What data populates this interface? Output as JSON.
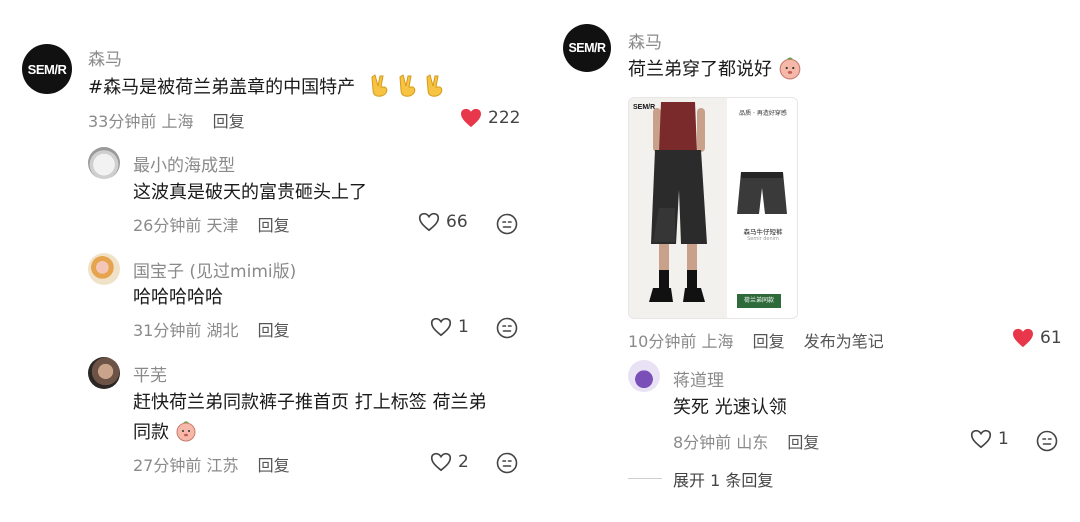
{
  "left": {
    "main_comment": {
      "author": "森马",
      "avatar_text": "SEM/R",
      "text": "#森马是被荷兰弟盖章的中国特产",
      "time": "33分钟前",
      "location": "上海",
      "reply_label": "回复",
      "likes": "222"
    },
    "replies": [
      {
        "author": "最小的海成型",
        "text": "这波真是破天的富贵砸头上了",
        "time": "26分钟前",
        "location": "天津",
        "reply_label": "回复",
        "likes": "66"
      },
      {
        "author": "国宝子 (见过mimi版)",
        "text": "哈哈哈哈哈",
        "time": "31分钟前",
        "location": "湖北",
        "reply_label": "回复",
        "likes": "1"
      },
      {
        "author": "平芜",
        "text_line1": "赶快荷兰弟同款裤子推首页 打上标签 荷兰弟",
        "text_line2": "同款",
        "time": "27分钟前",
        "location": "江苏",
        "reply_label": "回复",
        "likes": "2"
      }
    ]
  },
  "right": {
    "main_comment": {
      "author": "森马",
      "avatar_text": "SEM/R",
      "text": "荷兰弟穿了都说好",
      "time": "10分钟前",
      "location": "上海",
      "reply_label": "回复",
      "publish_note": "发布为笔记",
      "likes": "61"
    },
    "product": {
      "brand": "SEM/R",
      "header": "品质 · 再造好穿感",
      "item_name": "森马牛仔短裤",
      "item_sub": "Semir denim",
      "button": "荷兰弟同款"
    },
    "reply": {
      "author": "蒋道理",
      "text": "笑死 光速认领",
      "time": "8分钟前",
      "location": "山东",
      "reply_label": "回复",
      "likes": "1"
    },
    "expand_label": "展开 1 条回复"
  },
  "colors": {
    "heart_red": "#e8364a",
    "meta_gray": "#8a8a8a"
  },
  "icons": [
    "heart-filled-icon",
    "heart-outline-icon",
    "emoji-face-icon",
    "victory-hand-icon",
    "peach-emoji-icon"
  ]
}
